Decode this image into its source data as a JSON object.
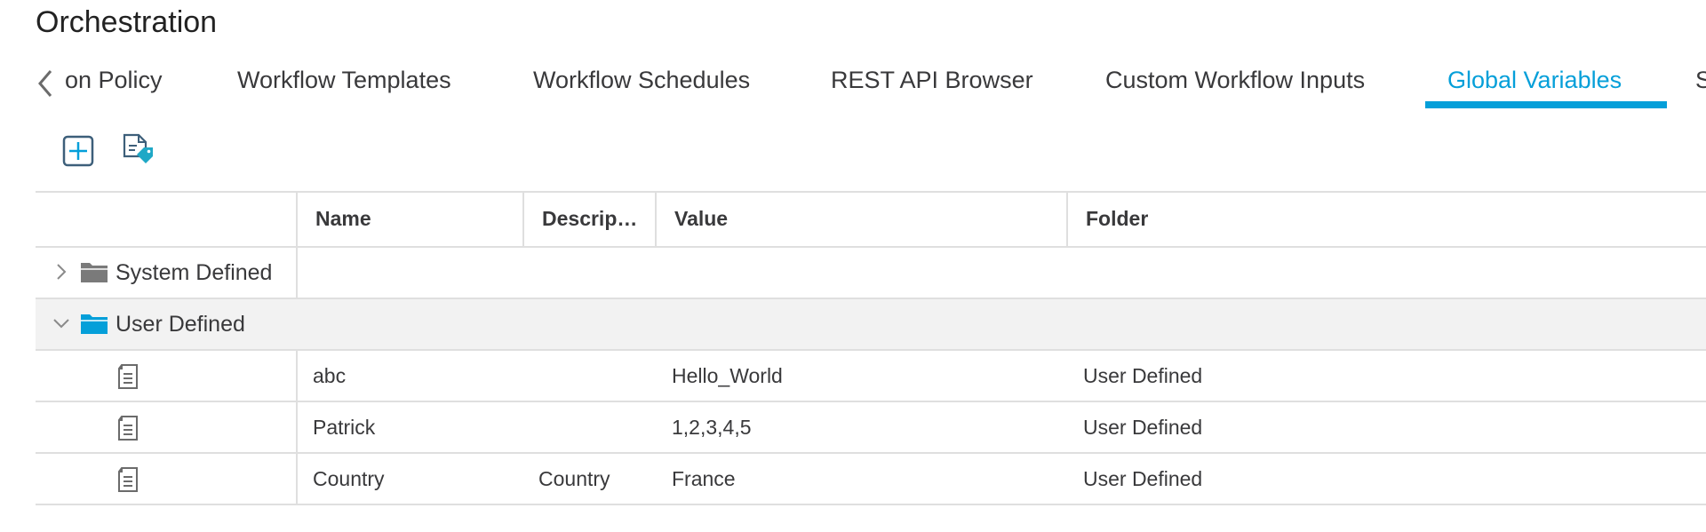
{
  "page": {
    "title": "Orchestration"
  },
  "tabs": [
    {
      "label": "on Policy",
      "active": false
    },
    {
      "label": "Workflow Templates",
      "active": false
    },
    {
      "label": "Workflow Schedules",
      "active": false
    },
    {
      "label": "REST API Browser",
      "active": false
    },
    {
      "label": "Custom Workflow Inputs",
      "active": false
    },
    {
      "label": "Global Variables",
      "active": true
    },
    {
      "label": "S",
      "active": false
    }
  ],
  "toolbar": {
    "add_icon": "add-square-icon",
    "tag_icon": "document-tag-icon"
  },
  "table": {
    "columns": [
      "Name",
      "Descrip…",
      "Value",
      "Folder"
    ],
    "groups": [
      {
        "label": "System Defined",
        "expanded": false,
        "folder_color": "#7a7a7a",
        "rows": []
      },
      {
        "label": "User Defined",
        "expanded": true,
        "folder_color": "#049fd9",
        "rows": [
          {
            "name": "abc",
            "description": "",
            "value": "Hello_World",
            "folder": "User Defined"
          },
          {
            "name": "Patrick",
            "description": "",
            "value": "1,2,3,4,5",
            "folder": "User Defined"
          },
          {
            "name": "Country",
            "description": "Country",
            "value": "France",
            "folder": "User Defined"
          }
        ]
      }
    ]
  },
  "colors": {
    "accent": "#049fd9",
    "text": "#39393b",
    "border": "#dfdfdf",
    "selected_row": "#f2f2f2"
  }
}
